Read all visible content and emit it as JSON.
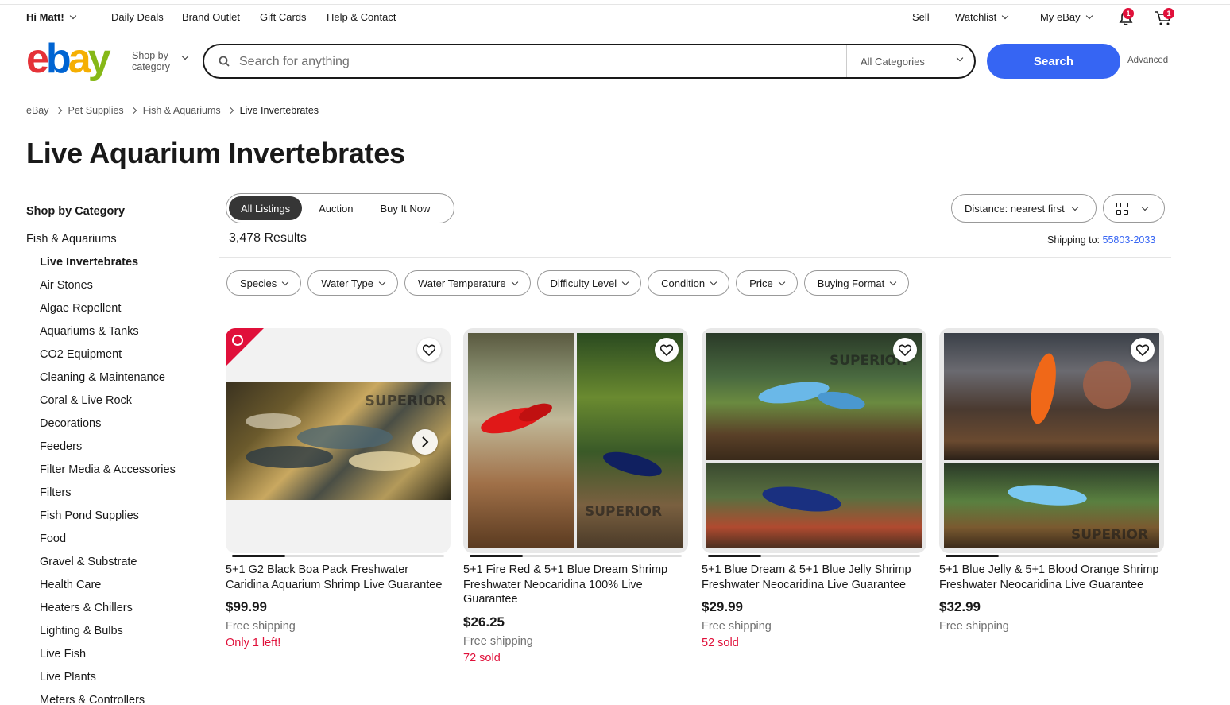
{
  "topbar": {
    "greeting": "Hi Matt!",
    "daily_deals": "Daily Deals",
    "brand_outlet": "Brand Outlet",
    "gift_cards": "Gift Cards",
    "help": "Help & Contact",
    "sell": "Sell",
    "watchlist": "Watchlist",
    "my_ebay": "My eBay",
    "notification_count": "1",
    "cart_count": "1"
  },
  "header": {
    "logo": {
      "e": "e",
      "b": "b",
      "a": "a",
      "y": "y"
    },
    "shop_by_line1": "Shop by",
    "shop_by_line2": "category",
    "search_placeholder": "Search for anything",
    "category_select": "All Categories",
    "search_button": "Search",
    "advanced": "Advanced"
  },
  "breadcrumb": [
    "eBay",
    "Pet Supplies",
    "Fish & Aquariums",
    "Live Invertebrates"
  ],
  "page_title": "Live Aquarium Invertebrates",
  "sidebar": {
    "heading": "Shop by Category",
    "parent": "Fish & Aquariums",
    "items": [
      "Live Invertebrates",
      "Air Stones",
      "Algae Repellent",
      "Aquariums & Tanks",
      "CO2 Equipment",
      "Cleaning & Maintenance",
      "Coral & Live Rock",
      "Decorations",
      "Feeders",
      "Filter Media & Accessories",
      "Filters",
      "Fish Pond Supplies",
      "Food",
      "Gravel & Substrate",
      "Health Care",
      "Heaters & Chillers",
      "Lighting & Bulbs",
      "Live Fish",
      "Live Plants",
      "Meters & Controllers"
    ]
  },
  "listing_format": [
    "All Listings",
    "Auction",
    "Buy It Now"
  ],
  "results": "3,478 Results",
  "sort": "Distance: nearest first",
  "shipping_to_label": "Shipping to:",
  "shipping_to_zip": "55803-2033",
  "filters": [
    "Species",
    "Water Type",
    "Water Temperature",
    "Difficulty Level",
    "Condition",
    "Price",
    "Buying Format"
  ],
  "products": [
    {
      "title": "5+1 G2 Black Boa Pack Freshwater Caridina Aquarium Shrimp Live Guarantee",
      "price": "$99.99",
      "shipping": "Free shipping",
      "status": "Only 1 left!",
      "image_progress": 0.25
    },
    {
      "title": "5+1 Fire Red & 5+1 Blue Dream Shrimp Freshwater Neocaridina 100% Live Guarantee",
      "price": "$26.25",
      "shipping": "Free shipping",
      "status": "72 sold",
      "image_progress": 0.25
    },
    {
      "title": "5+1 Blue Dream & 5+1 Blue Jelly Shrimp Freshwater Neocaridina Live Guarantee",
      "price": "$29.99",
      "shipping": "Free shipping",
      "status": "52 sold",
      "image_progress": 0.25
    },
    {
      "title": "5+1 Blue Jelly & 5+1 Blood Orange Shrimp Freshwater Neocaridina Live Guarantee",
      "price": "$32.99",
      "shipping": "Free shipping",
      "status": "",
      "image_progress": 0.25
    }
  ],
  "watermark": "SUPERIOR",
  "colors": {
    "accent": "#3665f3",
    "alert": "#e0103a",
    "logo_e": "#e53238",
    "logo_b": "#0064d2",
    "logo_a": "#f5af02",
    "logo_y": "#86b817"
  }
}
